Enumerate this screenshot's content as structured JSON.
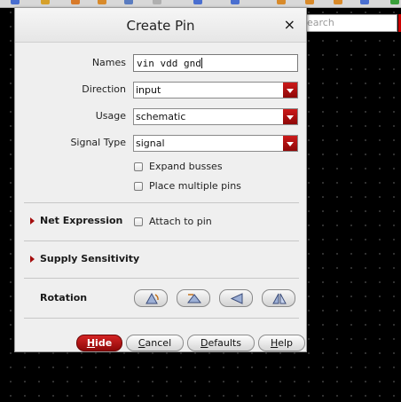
{
  "background": {
    "search_placeholder": "earch"
  },
  "dialog": {
    "title": "Create Pin",
    "close_glyph": "×",
    "names_label": "Names",
    "names_value": "vin vdd gnd",
    "direction_label": "Direction",
    "direction_value": "input",
    "usage_label": "Usage",
    "usage_value": "schematic",
    "signal_type_label": "Signal Type",
    "signal_type_value": "signal",
    "expand_busses_label": "Expand busses",
    "expand_busses_checked": false,
    "place_multiple_label": "Place multiple pins",
    "place_multiple_checked": false,
    "net_expression_label": "Net Expression",
    "attach_to_pin_label": "Attach to pin",
    "attach_to_pin_checked": false,
    "supply_sensitivity_label": "Supply Sensitivity",
    "rotation_label": "Rotation",
    "rotation_buttons": [
      "rotate-icon",
      "sideways-icon",
      "upside-down-icon",
      "mirror-icon"
    ]
  },
  "buttons": {
    "hide": {
      "key": "H",
      "rest": "ide"
    },
    "cancel": {
      "key": "C",
      "rest": "ancel"
    },
    "defaults": {
      "key": "D",
      "rest": "efaults"
    },
    "help": {
      "key": "H",
      "rest": "elp"
    }
  },
  "colors": {
    "accent_red": "#b00d0d",
    "dialog_bg": "#efefef",
    "canvas_bg": "#000000"
  }
}
